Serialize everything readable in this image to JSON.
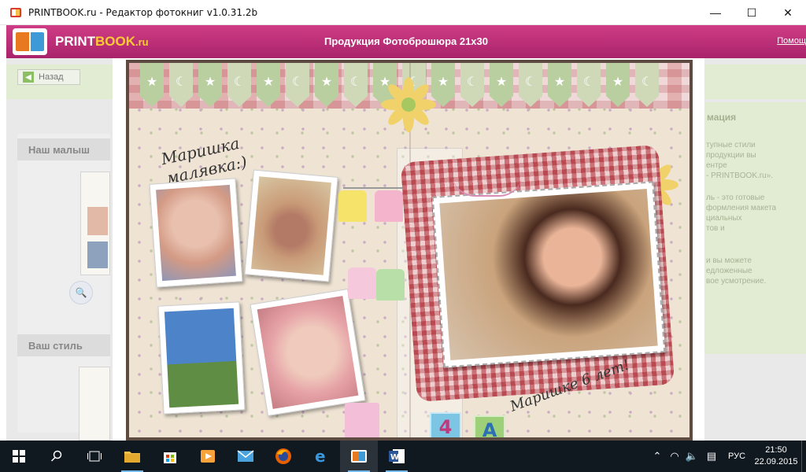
{
  "window": {
    "title": "PRINTBOOK.ru - Редактор фотокниг v1.0.31.2b",
    "controls": [
      "—",
      "☐",
      "✕"
    ]
  },
  "header": {
    "logo_main": "PRINT",
    "logo_accent": "BOOK",
    "logo_suffix": ".ru",
    "title": "Продукция Фотоброшюра 21x30",
    "help": "Помощ"
  },
  "toolbar": {
    "back_label": "Назад"
  },
  "sidebar": {
    "section1": "Наш малыш",
    "section2": "Ваш стиль"
  },
  "info_panel": {
    "heading": "мация",
    "lines": [
      "тупные стили",
      "продукции вы",
      "ентре",
      "- PRINTBOOK.ru».",
      "ль - это готовые",
      "формления макета",
      "циальных",
      "тов и",
      "",
      "и вы можете",
      "едложенные",
      "вое усмотрение."
    ]
  },
  "book": {
    "caption_left_line1": "Маришка",
    "caption_left_line2": "малявка:)",
    "caption_right": "Маришке 6 лет!",
    "block_letters": [
      "4",
      "A"
    ]
  },
  "taskbar": {
    "lang": "РУС",
    "time": "21:50",
    "date": "22.09.2015",
    "apps": [
      "start",
      "search",
      "task-view",
      "file-explorer",
      "store",
      "media-player",
      "mail",
      "firefox",
      "edge",
      "printbook",
      "word"
    ]
  },
  "colors": {
    "header_pink": "#b92f78",
    "taskbar": "#101820",
    "frame_brown": "#5d4b42"
  }
}
